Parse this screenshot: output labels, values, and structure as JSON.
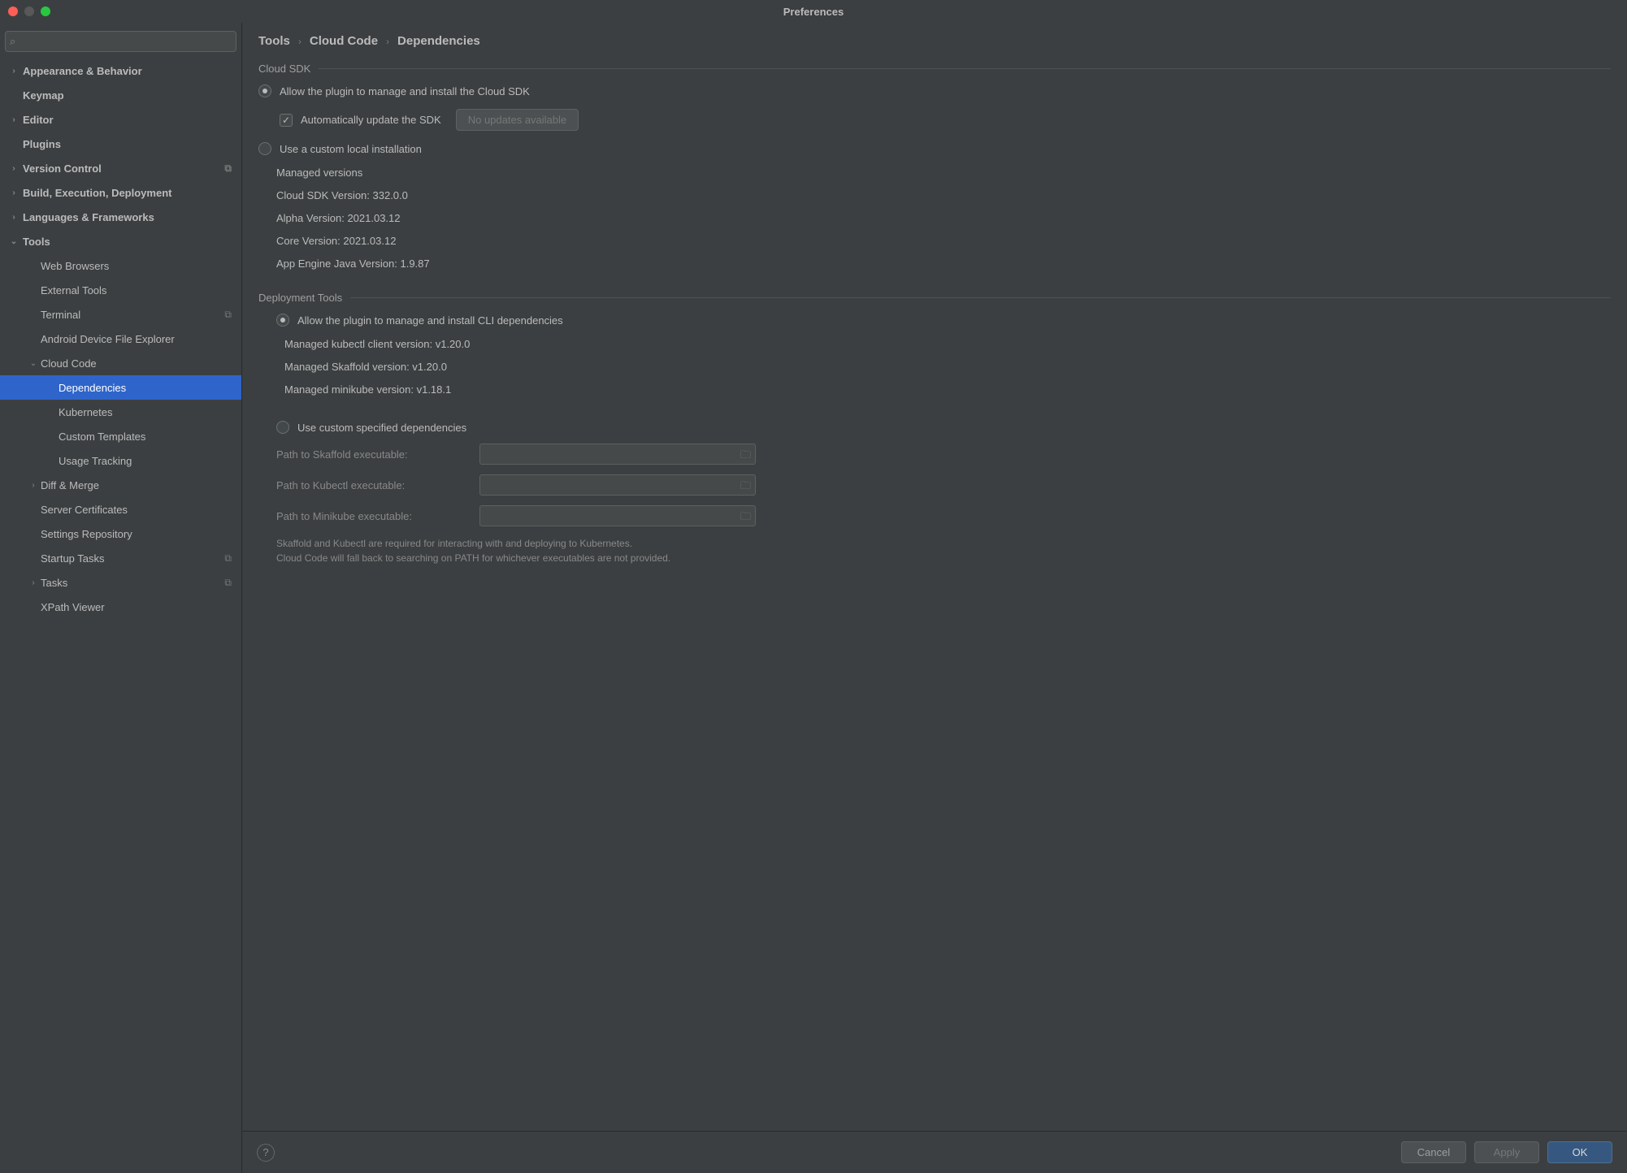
{
  "window": {
    "title": "Preferences"
  },
  "search": {
    "placeholder": ""
  },
  "sidebar": {
    "appearance": "Appearance & Behavior",
    "keymap": "Keymap",
    "editor": "Editor",
    "plugins": "Plugins",
    "version_control": "Version Control",
    "build": "Build, Execution, Deployment",
    "languages": "Languages & Frameworks",
    "tools": "Tools",
    "web_browsers": "Web Browsers",
    "external_tools": "External Tools",
    "terminal": "Terminal",
    "android": "Android Device File Explorer",
    "cloud_code": "Cloud Code",
    "dependencies": "Dependencies",
    "kubernetes": "Kubernetes",
    "custom_templates": "Custom Templates",
    "usage_tracking": "Usage Tracking",
    "diff_merge": "Diff & Merge",
    "server_certs": "Server Certificates",
    "settings_repo": "Settings Repository",
    "startup_tasks": "Startup Tasks",
    "tasks": "Tasks",
    "xpath": "XPath Viewer"
  },
  "breadcrumb": {
    "a": "Tools",
    "b": "Cloud Code",
    "c": "Dependencies"
  },
  "cloud_sdk": {
    "heading": "Cloud SDK",
    "radio_managed": "Allow the plugin to manage and install the Cloud SDK",
    "auto_update": "Automatically update the SDK",
    "no_updates_btn": "No updates available",
    "radio_custom": "Use a custom local installation",
    "managed_versions": "Managed versions",
    "sdk_version": "Cloud SDK Version: 332.0.0",
    "alpha_version": "Alpha Version: 2021.03.12",
    "core_version": "Core Version: 2021.03.12",
    "appengine_version": "App Engine Java Version: 1.9.87"
  },
  "deploy_tools": {
    "heading": "Deployment Tools",
    "radio_managed": "Allow the plugin to manage and install CLI dependencies",
    "kubectl_version": "Managed kubectl client version: v1.20.0",
    "skaffold_version": "Managed Skaffold version: v1.20.0",
    "minikube_version": "Managed minikube version: v1.18.1",
    "radio_custom": "Use custom specified dependencies",
    "path_skaffold": "Path to Skaffold executable:",
    "path_kubectl": "Path to Kubectl executable:",
    "path_minikube": "Path to Minikube executable:",
    "hint1": "Skaffold and Kubectl are required for interacting with and deploying to Kubernetes.",
    "hint2": "Cloud Code will fall back to searching on PATH for whichever executables are not provided."
  },
  "footer": {
    "cancel": "Cancel",
    "apply": "Apply",
    "ok": "OK"
  }
}
